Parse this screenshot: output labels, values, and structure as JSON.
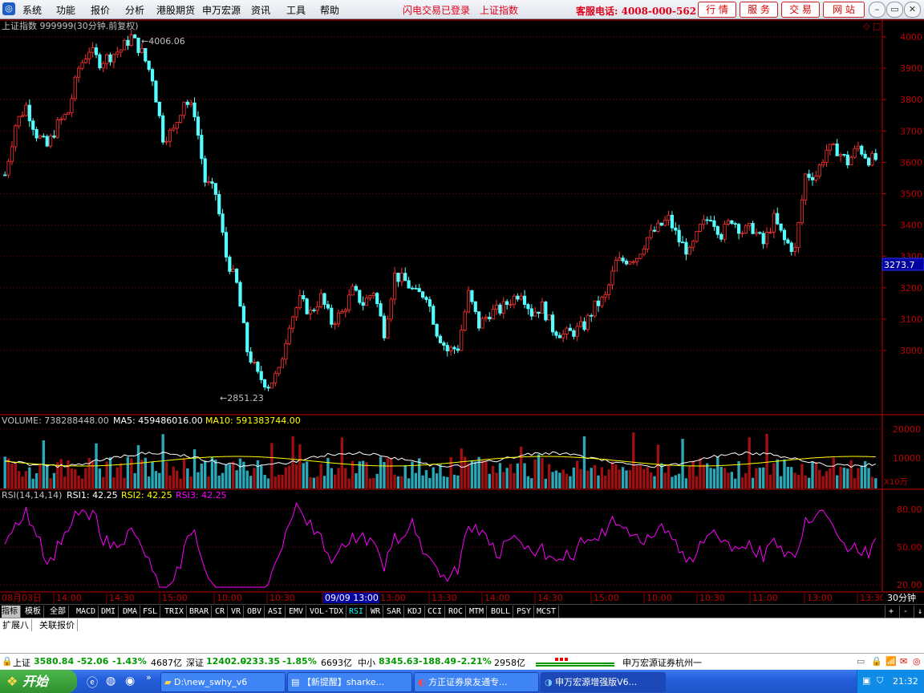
{
  "menubar": {
    "items": [
      "系统",
      "功能",
      "报价",
      "分析",
      "港股期货",
      "申万宏源",
      "资讯",
      "工具",
      "帮助"
    ],
    "flash_login": "闪电交易已登录",
    "current_index": "上证指数",
    "hotline": "客服电话: 4008-000-562",
    "top_buttons": [
      "行 情",
      "服 务",
      "交 易",
      "网 站"
    ],
    "window_buttons": [
      "@",
      "□",
      "x"
    ]
  },
  "chart": {
    "title": "上证指数 999999(30分钟.前复权)",
    "high_label": "4006.06",
    "low_label": "2851.23",
    "current_price_tag": "3273.7",
    "price_ticks": [
      "4000",
      "3900",
      "3800",
      "3700",
      "3600",
      "3500",
      "3400",
      "3300",
      "3200",
      "3100",
      "3000"
    ],
    "volume_header": {
      "vol": "VOLUME: 738288448.00",
      "ma5": "MA5: 459486016.00",
      "ma10": "MA10: 591383744.00"
    },
    "volume_ticks": [
      "20000",
      "10000"
    ],
    "volume_unit": "X10万",
    "rsi_header": {
      "name": "RSI(14,14,14)",
      "rsi1": "RSI1: 42.25",
      "rsi2": "RSI2: 42.25",
      "rsi3": "RSI3: 42.25"
    },
    "rsi_ticks": [
      "80.00",
      "50.00",
      "20.00"
    ],
    "time_axis": [
      "08月03日",
      "14:00",
      "14:30",
      "15:00",
      "10:00",
      "10:30",
      "09/09 13:00",
      "13:00",
      "13:30",
      "14:00",
      "14:30",
      "15:00",
      "10:00",
      "10:30",
      "11:00",
      "13:00",
      "13:30"
    ],
    "period": "30分钟"
  },
  "chart_data": {
    "type": "candlestick",
    "title": "上证指数 999999(30分钟.前复权)",
    "ylim": [
      2851.23,
      4006.06
    ],
    "y_ticks": [
      3000,
      3100,
      3200,
      3300,
      3400,
      3500,
      3600,
      3700,
      3800,
      3900,
      4000
    ],
    "annotations": [
      {
        "label": "4006.06",
        "type": "high"
      },
      {
        "label": "2851.23",
        "type": "low"
      }
    ],
    "close_path": [
      3560,
      3720,
      3780,
      3690,
      3650,
      3720,
      3760,
      3900,
      3960,
      3920,
      3940,
      3960,
      4000,
      3950,
      3870,
      3680,
      3700,
      3800,
      3760,
      3540,
      3500,
      3300,
      3210,
      3000,
      2920,
      2890,
      2930,
      3090,
      3160,
      3120,
      3170,
      3090,
      3120,
      3190,
      3150,
      3190,
      3060,
      3240,
      3220,
      3180,
      3180,
      3060,
      3000,
      3010,
      3180,
      3080,
      3120,
      3130,
      3160,
      3190,
      3120,
      3140,
      3070,
      3050,
      3060,
      3080,
      3140,
      3170,
      3280,
      3290,
      3300,
      3360,
      3390,
      3420,
      3350,
      3310,
      3390,
      3430,
      3370,
      3420,
      3380,
      3390,
      3340,
      3420,
      3350,
      3320,
      3560,
      3560,
      3640,
      3640,
      3600,
      3650,
      3610,
      3610
    ]
  },
  "function_bar": [
    "指标",
    "模板",
    "全部",
    "MACD",
    "DMI",
    "DMA",
    "FSL",
    "TRIX",
    "BRAR",
    "CR",
    "VR",
    "OBV",
    "ASI",
    "EMV",
    "VOL-TDX",
    "RSI",
    "WR",
    "SAR",
    "KDJ",
    "CCI",
    "ROC",
    "MTM",
    "BOLL",
    "PSY",
    "MCST"
  ],
  "function_bar_right": [
    "+",
    "-",
    "↓"
  ],
  "bottom_tabs": [
    "扩展八",
    "关联报价"
  ],
  "status": {
    "sh": {
      "name": "上证",
      "value": "3580.84",
      "change": "-52.06",
      "pct": "-1.43%",
      "amount": "4687亿"
    },
    "sz": {
      "name": "深证",
      "value": "12402.0",
      "change": "-233.35",
      "pct": "-1.85%",
      "amount": "6693亿"
    },
    "zx": {
      "name": "中小",
      "value": "8345.63",
      "change": "-188.49",
      "pct": "-2.21%",
      "amount": "2958亿"
    },
    "broker": "申万宏源证券杭州一"
  },
  "taskbar": {
    "start_label": "开始",
    "tasks": [
      "D:\\new_swhy_v6",
      "【新提醒】sharke...",
      "方正证券泉友通专...",
      "申万宏源增强版V6..."
    ],
    "clock": "21:32"
  },
  "colors": {
    "up": "#ff3232",
    "down": "#54ffff",
    "ma5": "#ffffff",
    "ma10": "#ffff00",
    "rsi": "#ff00ff",
    "axis": "#c00000"
  }
}
